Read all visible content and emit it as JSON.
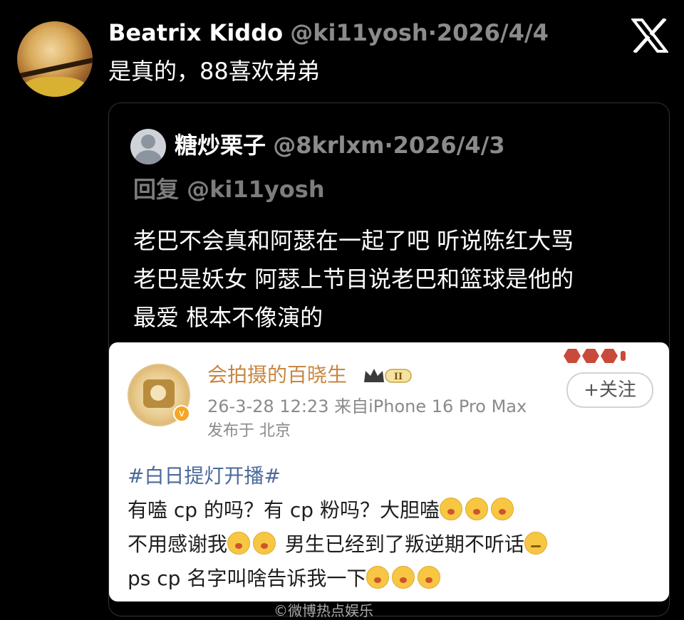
{
  "tweet": {
    "author_name": "Beatrix Kiddo",
    "author_handle": "@ki11yosh",
    "separator": "·",
    "date": "2026/4/4",
    "text": "是真的，88喜欢弟弟"
  },
  "quoted": {
    "author_name": "糖炒栗子",
    "author_handle": "@8krlxm",
    "separator": "·",
    "date": "2026/4/3",
    "reply_to": "回复 @ki11yosh",
    "lines": [
      "老巴不会真和阿瑟在一起了吧 听说陈红大骂",
      "老巴是妖女 阿瑟上节目说老巴和篮球是他的",
      "最爱 根本不像演的"
    ]
  },
  "weibo": {
    "name": "会拍摄的百晓生",
    "level": "II",
    "verified_mark": "v",
    "time_source": "26-3-28 12:23 来自iPhone 16 Pro Max",
    "location": "发布于 北京",
    "follow_label": "+关注",
    "hashtag": "#白日提灯开播#",
    "line1": "有嗑 cp 的吗？有 cp 粉吗？大胆嗑",
    "line2a": "不用感谢我",
    "line2b": " 男生已经到了叛逆期不听话",
    "line3": "ps cp 名字叫啥告诉我一下"
  },
  "icons": {
    "x_logo": "x-logo-icon",
    "default_avatar": "default-avatar-icon",
    "emoji": "yawn-emoji-icon",
    "emoji_smirk": "smirk-emoji-icon"
  },
  "colors": {
    "background": "#000000",
    "secondary_text": "#8b8b8b",
    "weibo_name": "#c8863f",
    "hashtag": "#4a6a9a"
  },
  "footer_caption": "©微博热点娱乐"
}
